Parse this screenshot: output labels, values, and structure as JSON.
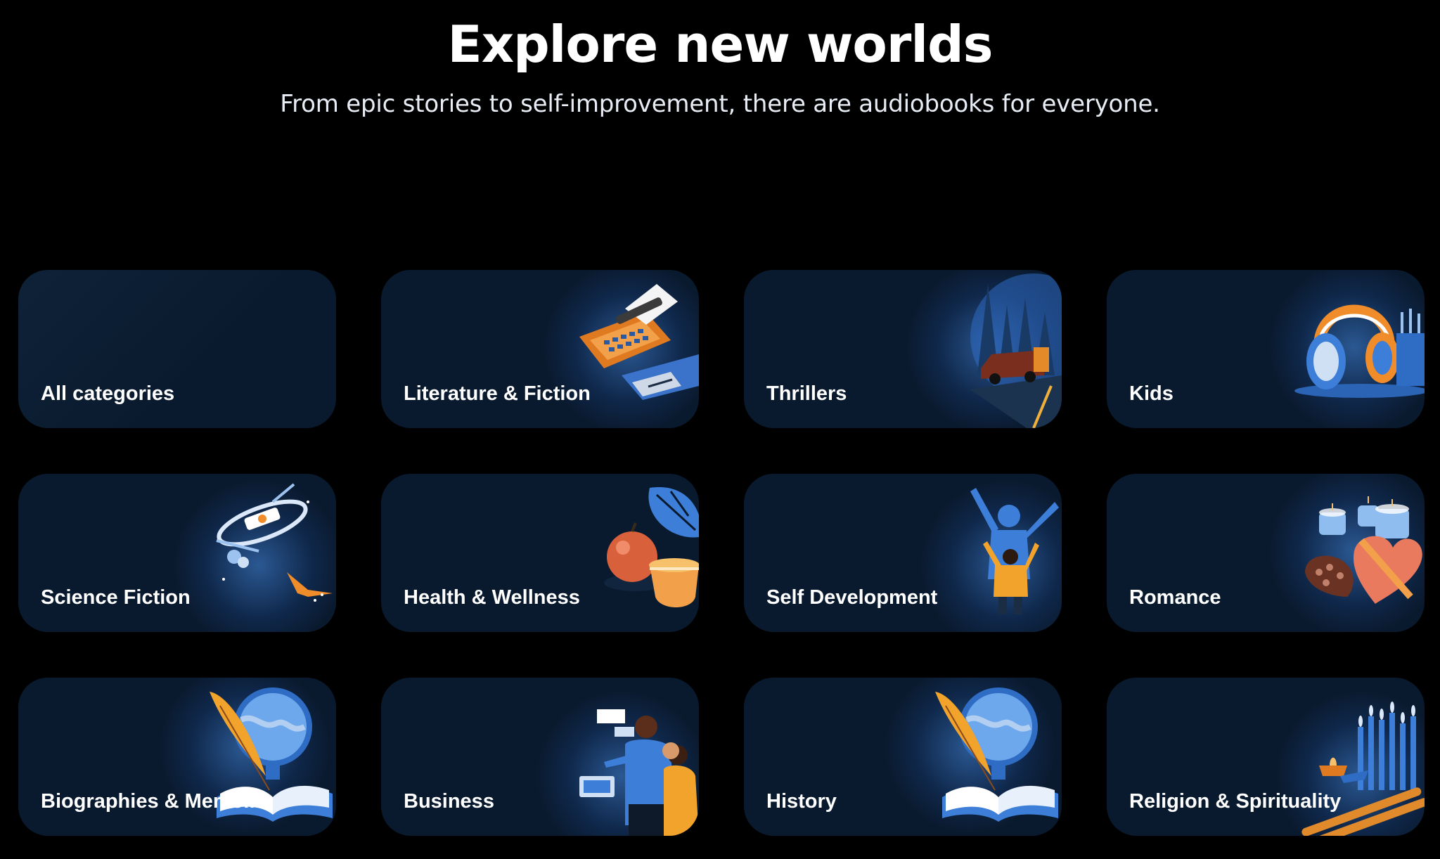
{
  "header": {
    "title": "Explore new worlds",
    "subtitle": "From epic stories to self-improvement, there are audiobooks for everyone."
  },
  "categories": [
    {
      "label": "All categories",
      "icon": "none"
    },
    {
      "label": "Literature & Fiction",
      "icon": "typewriter-icon"
    },
    {
      "label": "Thrillers",
      "icon": "car-forest-icon"
    },
    {
      "label": "Kids",
      "icon": "headphones-icon"
    },
    {
      "label": "Science Fiction",
      "icon": "space-station-icon"
    },
    {
      "label": "Health & Wellness",
      "icon": "apple-tea-icon"
    },
    {
      "label": "Self Development",
      "icon": "cheering-people-icon"
    },
    {
      "label": "Romance",
      "icon": "heart-chocolate-icon"
    },
    {
      "label": "Biographies & Memoirs",
      "icon": "globe-quill-icon"
    },
    {
      "label": "Business",
      "icon": "meeting-people-icon"
    },
    {
      "label": "History",
      "icon": "globe-quill-icon"
    },
    {
      "label": "Religion & Spirituality",
      "icon": "candles-icon"
    }
  ],
  "colors": {
    "background": "#000000",
    "card": "#0a1a2e",
    "accent_orange": "#f0922b",
    "accent_blue": "#3f86e0"
  }
}
